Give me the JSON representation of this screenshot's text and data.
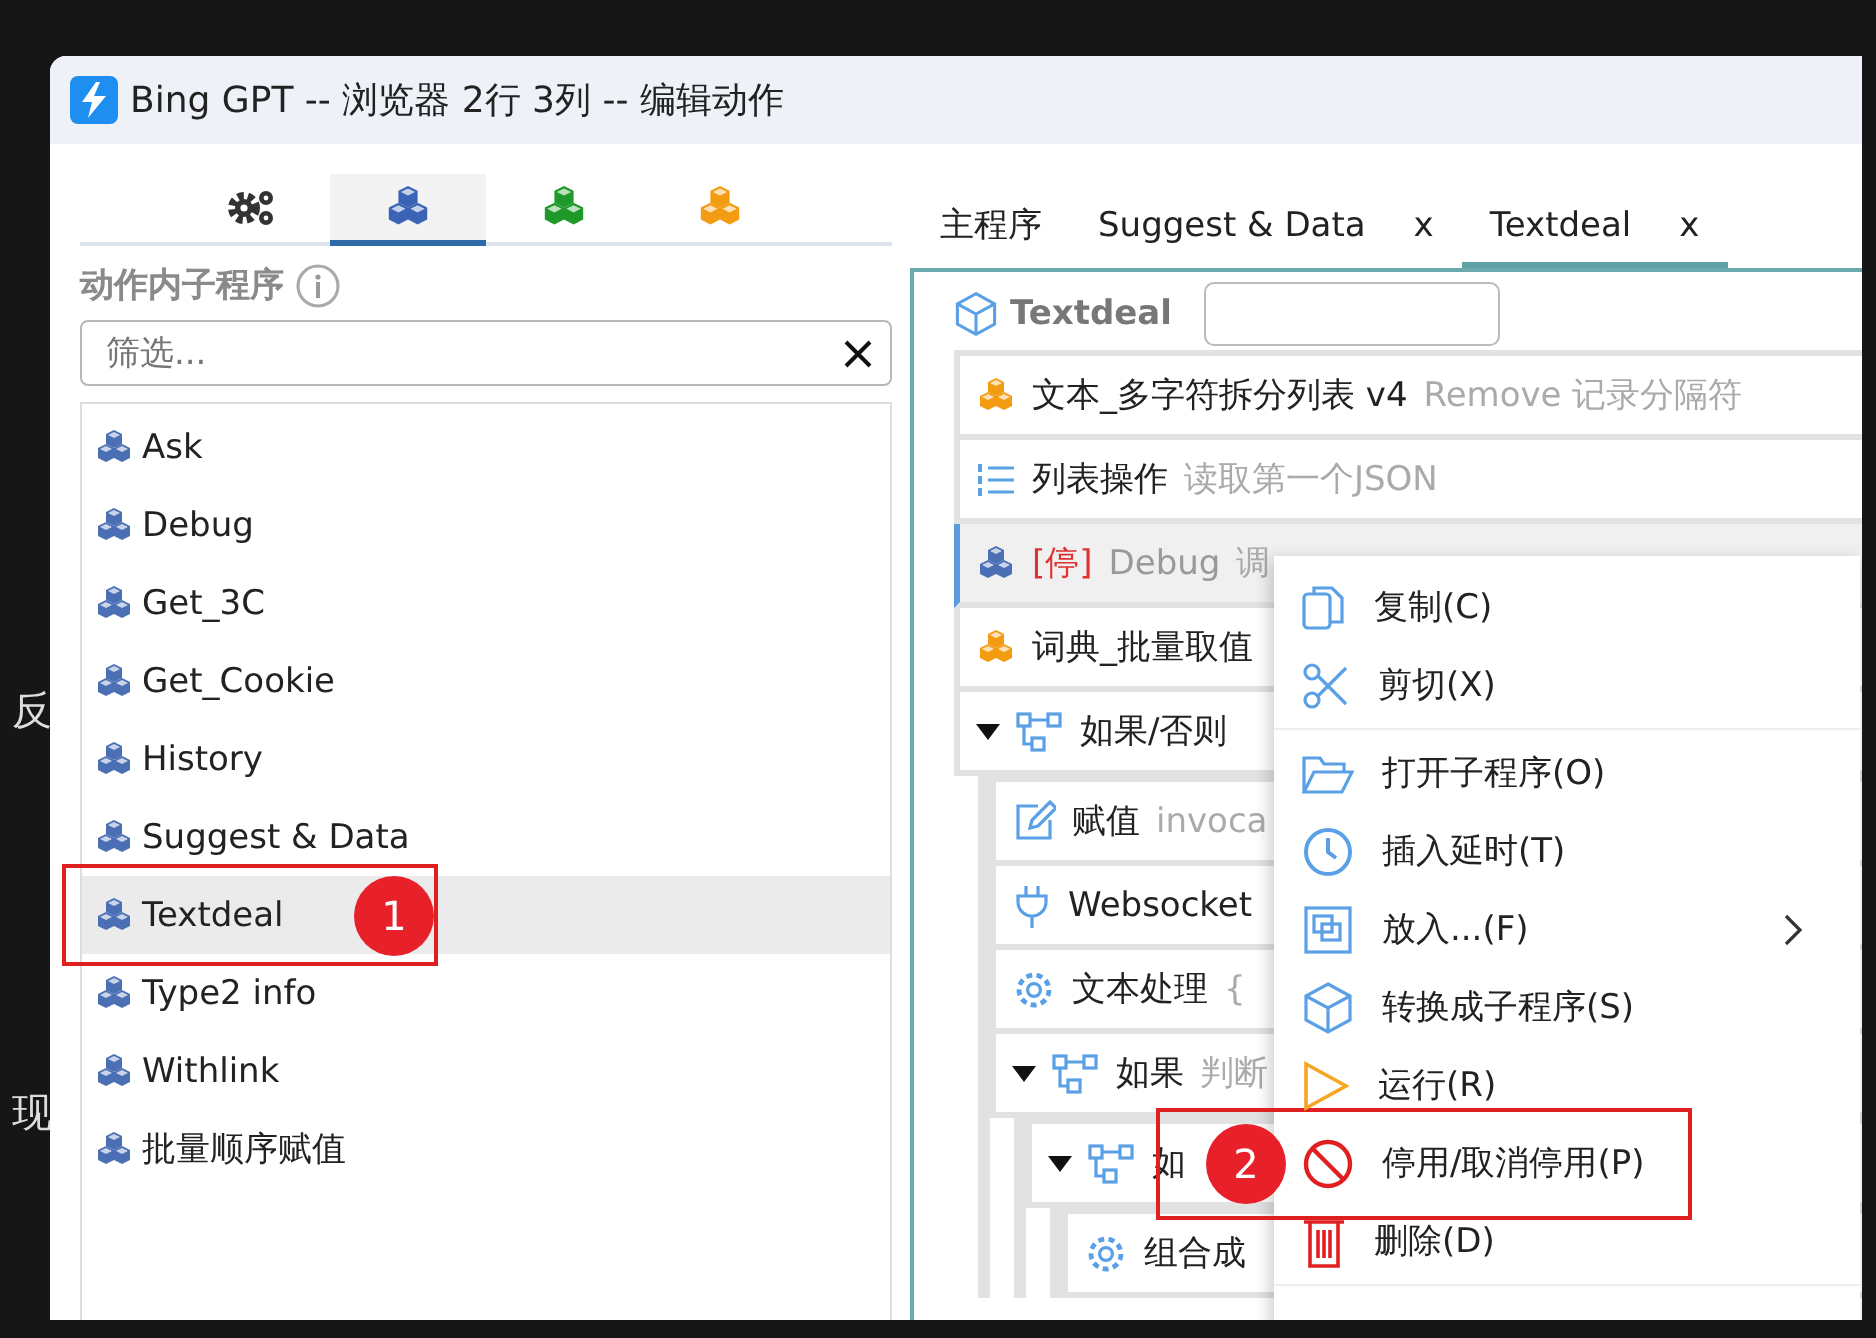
{
  "background_fragments": [
    "反",
    "现"
  ],
  "window": {
    "title": "Bing GPT -- 浏览器 2行 3列 -- 编辑动作"
  },
  "left_tabs": [
    {
      "kind": "gears",
      "selected": false
    },
    {
      "kind": "blue",
      "selected": true
    },
    {
      "kind": "green",
      "selected": false
    },
    {
      "kind": "orange",
      "selected": false
    }
  ],
  "section_title": "动作内子程序",
  "filter": {
    "placeholder": "筛选..."
  },
  "subprograms": [
    {
      "label": "Ask",
      "selected": false
    },
    {
      "label": "Debug",
      "selected": false
    },
    {
      "label": "Get_3C",
      "selected": false
    },
    {
      "label": "Get_Cookie",
      "selected": false
    },
    {
      "label": "History",
      "selected": false
    },
    {
      "label": "Suggest & Data",
      "selected": false
    },
    {
      "label": "Textdeal",
      "selected": true,
      "callout": "1"
    },
    {
      "label": "Type2 info",
      "selected": false
    },
    {
      "label": "Withlink",
      "selected": false
    },
    {
      "label": "批量顺序赋值",
      "selected": false
    }
  ],
  "editor_tabs": [
    {
      "label": "主程序",
      "selected": false
    },
    {
      "label": "Suggest & Data",
      "close": "x",
      "selected": false
    },
    {
      "label": "Textdeal",
      "close": "x",
      "selected": true
    }
  ],
  "editor": {
    "title": "Textdeal",
    "actions": [
      {
        "kind": "library",
        "title": "文本_多字符拆分列表 v4",
        "note": "Remove 记录分隔符",
        "disabled": false,
        "selected": false
      },
      {
        "kind": "list",
        "title": "列表操作",
        "note": "读取第一个JSON",
        "disabled": false,
        "selected": false
      },
      {
        "kind": "local",
        "tag": "[停]",
        "title": "Debug",
        "note": "调",
        "disabled": true,
        "selected": true
      },
      {
        "kind": "library",
        "title": "词典_批量取值",
        "disabled": false,
        "selected": false
      },
      {
        "kind": "if",
        "title": "如果/否则",
        "expanded": true,
        "disabled": false,
        "selected": false,
        "children": [
          {
            "kind": "assign",
            "title": "赋值",
            "note": "invoca",
            "disabled": false,
            "selected": false
          },
          {
            "kind": "plug",
            "title": "Websocket",
            "disabled": false,
            "selected": false
          },
          {
            "kind": "gear",
            "title": "文本处理",
            "note": "{",
            "disabled": false,
            "selected": false
          },
          {
            "kind": "if",
            "title": "如果",
            "note": "判断",
            "expanded": true,
            "disabled": false,
            "selected": false,
            "children": [
              {
                "kind": "if",
                "title": "如",
                "expanded": true,
                "disabled": false,
                "selected": false,
                "children": [
                  {
                    "kind": "gear",
                    "title": "组合成",
                    "disabled": false,
                    "selected": false
                  }
                ]
              }
            ]
          }
        ]
      }
    ]
  },
  "context_menu": {
    "groups": [
      [
        {
          "kind": "copy",
          "label": "复制(C)"
        },
        {
          "kind": "cut",
          "label": "剪切(X)"
        }
      ],
      [
        {
          "kind": "folder",
          "label": "打开子程序(O)"
        },
        {
          "kind": "clock",
          "label": "插入延时(T)"
        },
        {
          "kind": "frame",
          "label": "放入...(F)",
          "submenu": true
        },
        {
          "kind": "cube",
          "label": "转换成子程序(S)"
        },
        {
          "kind": "run",
          "label": "运行(R)"
        },
        {
          "kind": "stop",
          "label": "停用/取消停用(P)",
          "callout": "2"
        },
        {
          "kind": "delete",
          "label": "删除(D)"
        }
      ]
    ]
  }
}
